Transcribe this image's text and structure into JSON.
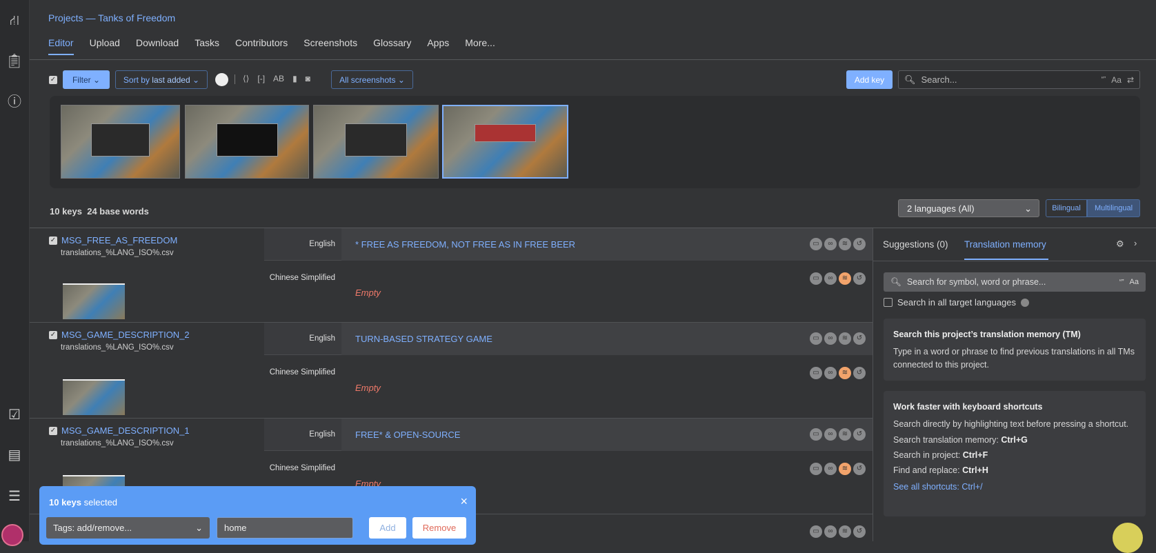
{
  "sidebar": {
    "icons": [
      "sitemap-icon",
      "clipboard-icon",
      "help-icon",
      "tasks-check-icon",
      "comment-icon",
      "list-icon",
      "avatar"
    ]
  },
  "header": {
    "breadcrumb": "Projects — Tanks of Freedom",
    "tabs": [
      "Editor",
      "Upload",
      "Download",
      "Tasks",
      "Contributors",
      "Screenshots",
      "Glossary",
      "Apps",
      "More..."
    ],
    "active_tab": "Editor"
  },
  "toolbar": {
    "filter": "Filter",
    "sort_prefix": "Sort by ",
    "sort_value": "last added",
    "screenshots": "All screenshots",
    "add_key": "Add key",
    "search_placeholder": "Search...",
    "search_opts": [
      "“”",
      "Aa",
      "⇄"
    ]
  },
  "stats": {
    "keys": "10 keys",
    "words": "24 base words"
  },
  "languages": {
    "select": "2 languages (All)",
    "bilingual": "Bilingual",
    "multilingual": "Multilingual",
    "active": "Multilingual"
  },
  "rows": [
    {
      "key": "MSG_FREE_AS_FREEDOM",
      "file": "translations_%LANG_ISO%.csv",
      "source_lang": "English",
      "source": "* FREE AS FREEDOM, NOT FREE AS IN FREE BEER",
      "target_lang": "Chinese Simplified",
      "target": "Empty"
    },
    {
      "key": "MSG_GAME_DESCRIPTION_2",
      "file": "translations_%LANG_ISO%.csv",
      "source_lang": "English",
      "source": "TURN-BASED STRATEGY GAME",
      "target_lang": "Chinese Simplified",
      "target": "Empty"
    },
    {
      "key": "MSG_GAME_DESCRIPTION_1",
      "file": "translations_%LANG_ISO%.csv",
      "source_lang": "English",
      "source": "FREE* & OPEN-SOURCE",
      "target_lang": "Chinese Simplified",
      "target": "Empty"
    }
  ],
  "panel": {
    "tab_suggestions": "Suggestions (0)",
    "tab_tm": "Translation memory",
    "tm_placeholder": "Search for symbol, word or phrase...",
    "all_langs": "Search in all target languages",
    "card1": {
      "title": "Search this project’s translation memory (TM)",
      "body": "Type in a word or phrase to find previous translations in all TMs connected to this project."
    },
    "card2": {
      "title": "Work faster with keyboard shortcuts",
      "body": "Search directly by highlighting text before pressing a shortcut.",
      "s1_label": "Search translation memory: ",
      "s1_key": "Ctrl+G",
      "s2_label": "Search in project: ",
      "s2_key": "Ctrl+F",
      "s3_label": "Find and replace: ",
      "s3_key": "Ctrl+H",
      "link": "See all shortcuts: Ctrl+/"
    }
  },
  "bulk": {
    "count": "10 keys",
    "selected": " selected",
    "tags_select": "Tags: add/remove...",
    "tag_value": "home",
    "add": "Add",
    "remove": "Remove",
    "close": "×"
  },
  "colors": {
    "accent": "#7fb0ff",
    "empty": "#f07a6a",
    "bulk_bar": "#5b9cf5"
  }
}
